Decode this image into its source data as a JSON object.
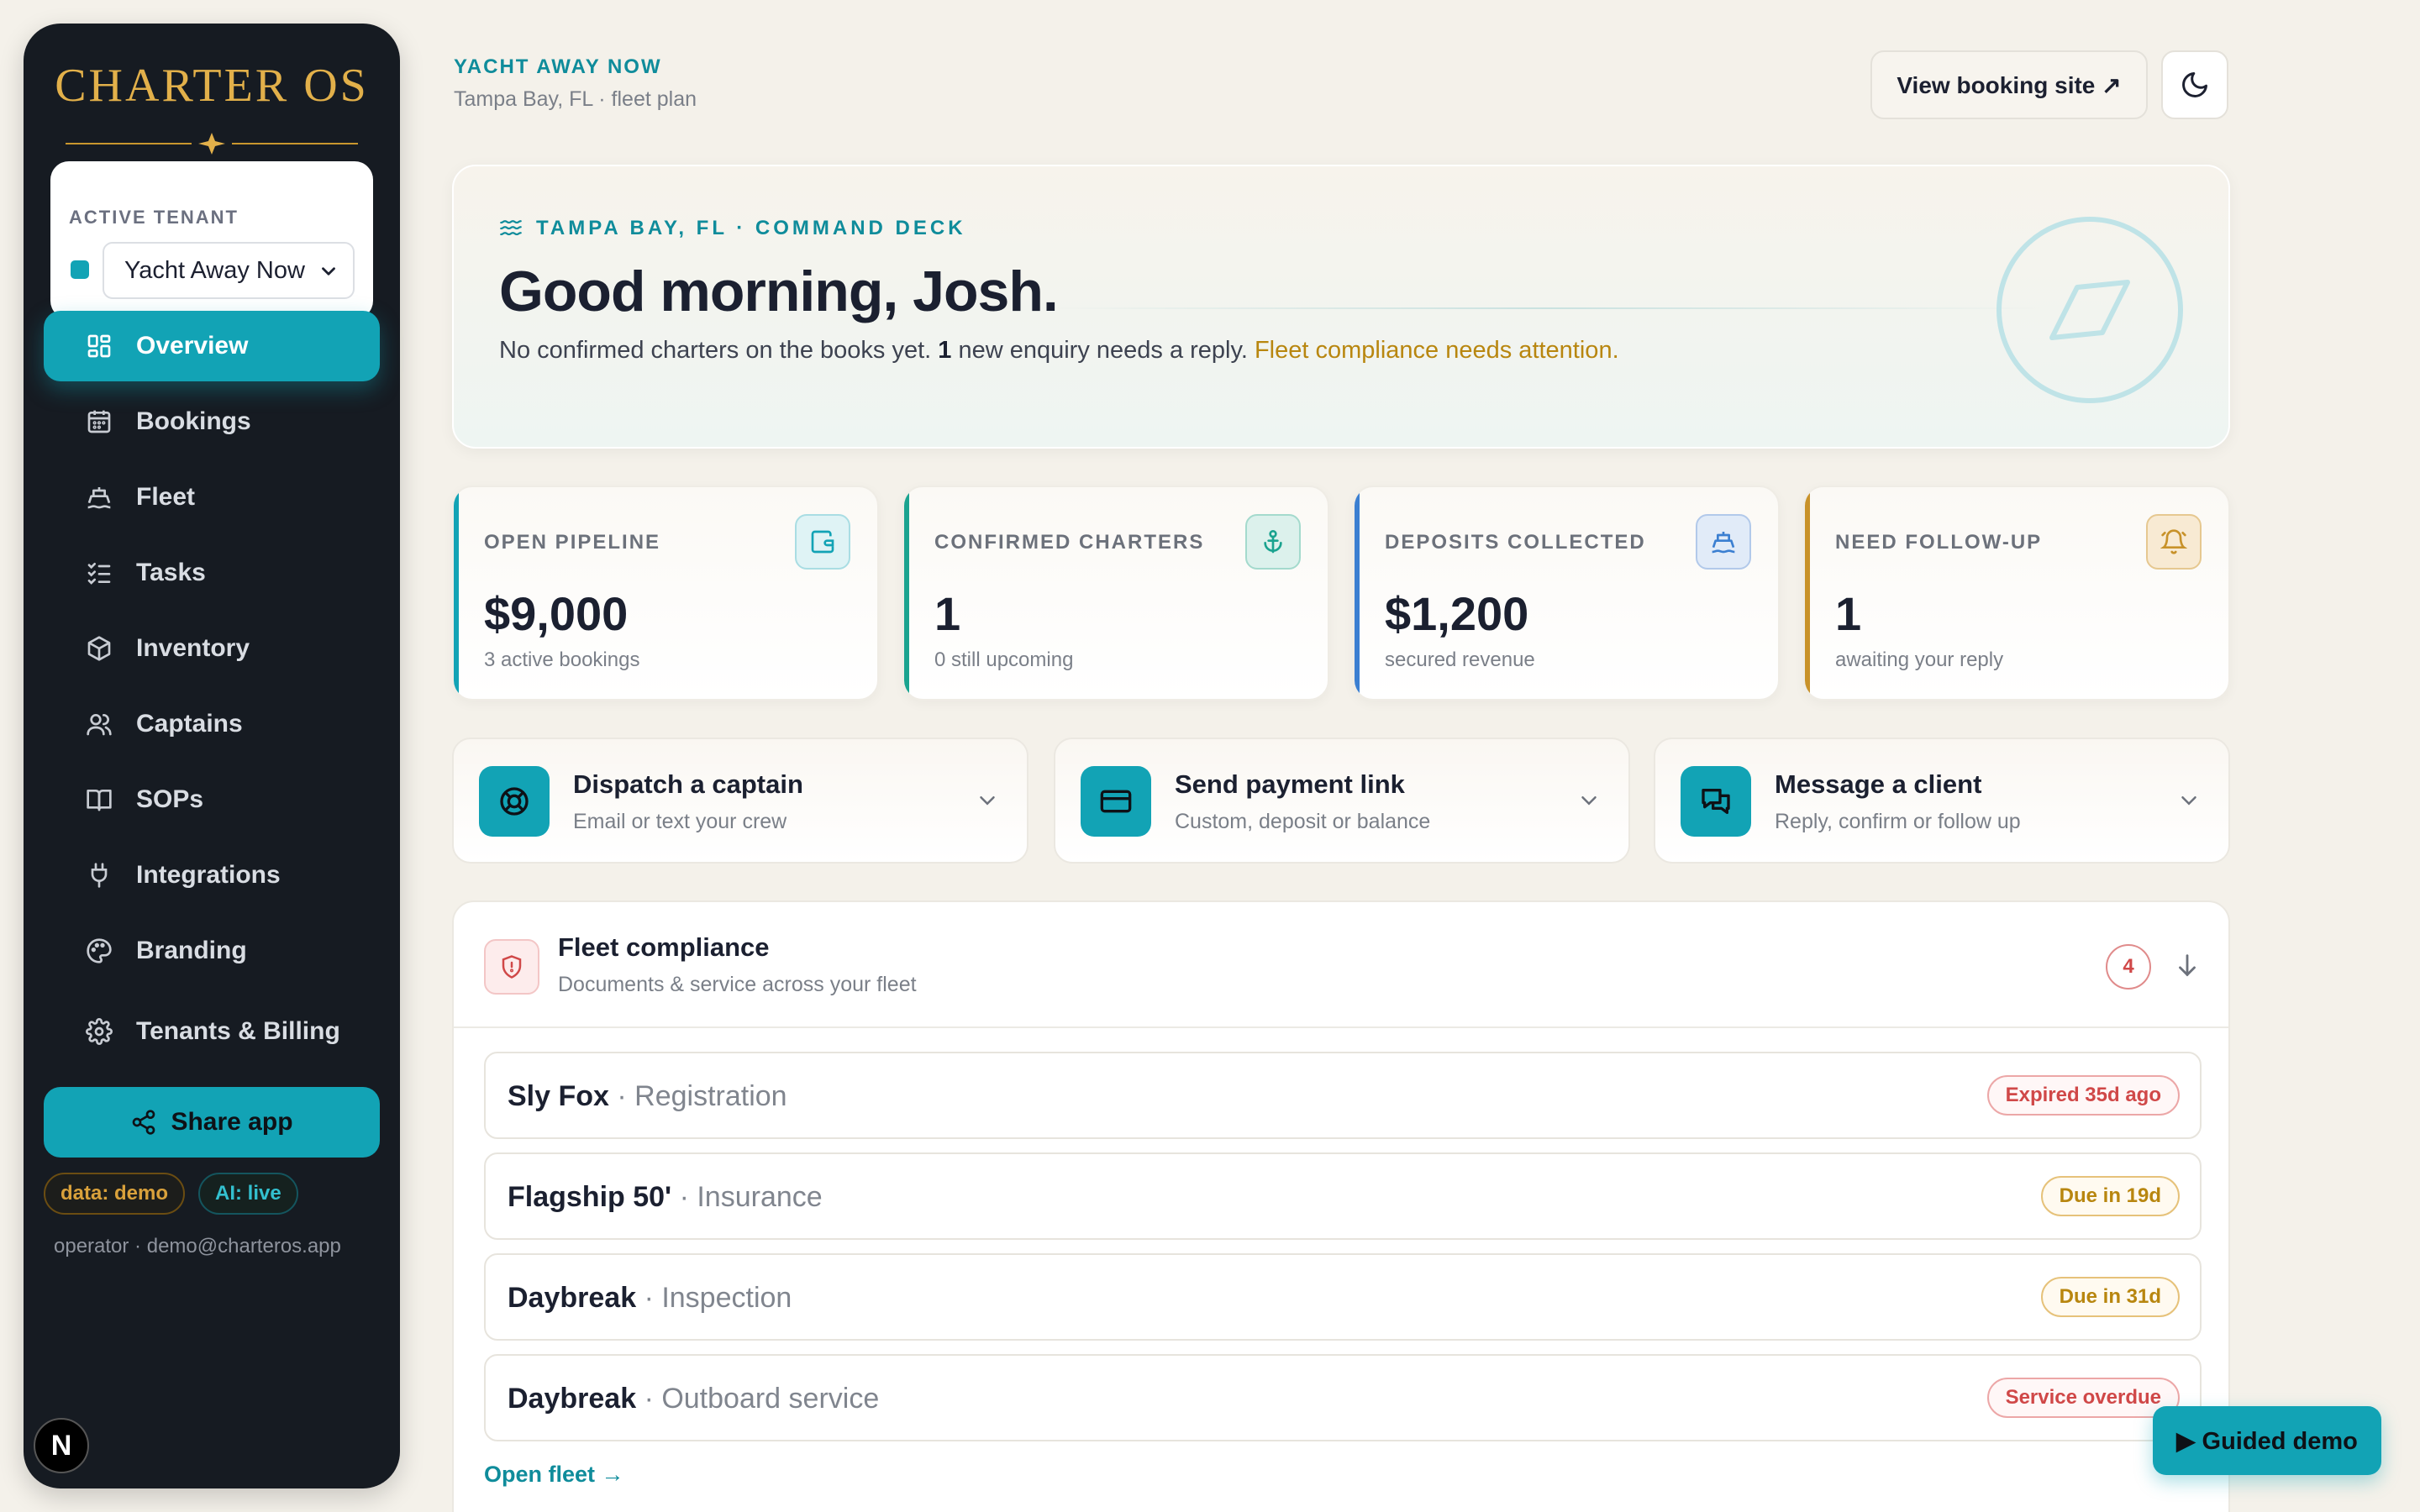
{
  "sidebar": {
    "brand": "CHARTER OS",
    "tenant_label": "ACTIVE TENANT",
    "tenant_value": "Yacht Away Now",
    "nav": [
      {
        "label": "Overview",
        "icon": "grid-icon",
        "active": true
      },
      {
        "label": "Bookings",
        "icon": "calendar-icon"
      },
      {
        "label": "Fleet",
        "icon": "boat-icon"
      },
      {
        "label": "Tasks",
        "icon": "checklist-icon"
      },
      {
        "label": "Inventory",
        "icon": "box-icon"
      },
      {
        "label": "Captains",
        "icon": "users-icon"
      },
      {
        "label": "SOPs",
        "icon": "book-icon"
      },
      {
        "label": "Integrations",
        "icon": "plug-icon"
      },
      {
        "label": "Branding",
        "icon": "palette-icon"
      },
      {
        "label": "Tenants & Billing",
        "icon": "gear-icon"
      }
    ],
    "share_label": "Share app",
    "pill_data": "data: demo",
    "pill_ai": "AI: live",
    "operator": "operator · demo@charteros.app",
    "n_badge": "N"
  },
  "header": {
    "company": "YACHT AWAY NOW",
    "subtitle": "Tampa Bay, FL · fleet plan",
    "view_site": "View booking site ↗"
  },
  "hero": {
    "tag": "TAMPA BAY, FL · COMMAND DECK",
    "greeting": "Good morning, Josh.",
    "text_before": "No confirmed charters on the books yet. ",
    "text_count": "1",
    "text_mid": " new enquiry needs a reply. ",
    "text_warn": "Fleet compliance needs attention."
  },
  "stats": [
    {
      "label": "OPEN PIPELINE",
      "value": "$9,000",
      "caption": "3 active bookings",
      "icon": "wallet-icon",
      "color": "#12a3b5"
    },
    {
      "label": "CONFIRMED CHARTERS",
      "value": "1",
      "caption": "0 still upcoming",
      "icon": "anchor-icon",
      "color": "#1aa38f"
    },
    {
      "label": "DEPOSITS COLLECTED",
      "value": "$1,200",
      "caption": "secured revenue",
      "icon": "ship-icon",
      "color": "#3b7fd1"
    },
    {
      "label": "NEED FOLLOW-UP",
      "value": "1",
      "caption": "awaiting your reply",
      "icon": "bell-icon",
      "color": "#c8922a"
    }
  ],
  "actions": [
    {
      "title": "Dispatch a captain",
      "sub": "Email or text your crew",
      "icon": "lifebuoy-icon"
    },
    {
      "title": "Send payment link",
      "sub": "Custom, deposit or balance",
      "icon": "card-icon"
    },
    {
      "title": "Message a client",
      "sub": "Reply, confirm or follow up",
      "icon": "chat-icon"
    }
  ],
  "compliance": {
    "title": "Fleet compliance",
    "subtitle": "Documents & service across your fleet",
    "count": "4",
    "rows": [
      {
        "name": "Sly Fox",
        "type": "· Registration",
        "badge": "Expired 35d ago",
        "tone": "red"
      },
      {
        "name": "Flagship 50'",
        "type": "· Insurance",
        "badge": "Due in 19d",
        "tone": "amber"
      },
      {
        "name": "Daybreak",
        "type": "· Inspection",
        "badge": "Due in 31d",
        "tone": "amber"
      },
      {
        "name": "Daybreak",
        "type": "· Outboard service",
        "badge": "Service overdue",
        "tone": "red"
      }
    ],
    "open_link": "Open fleet →"
  },
  "guided_demo": "▶ Guided demo"
}
